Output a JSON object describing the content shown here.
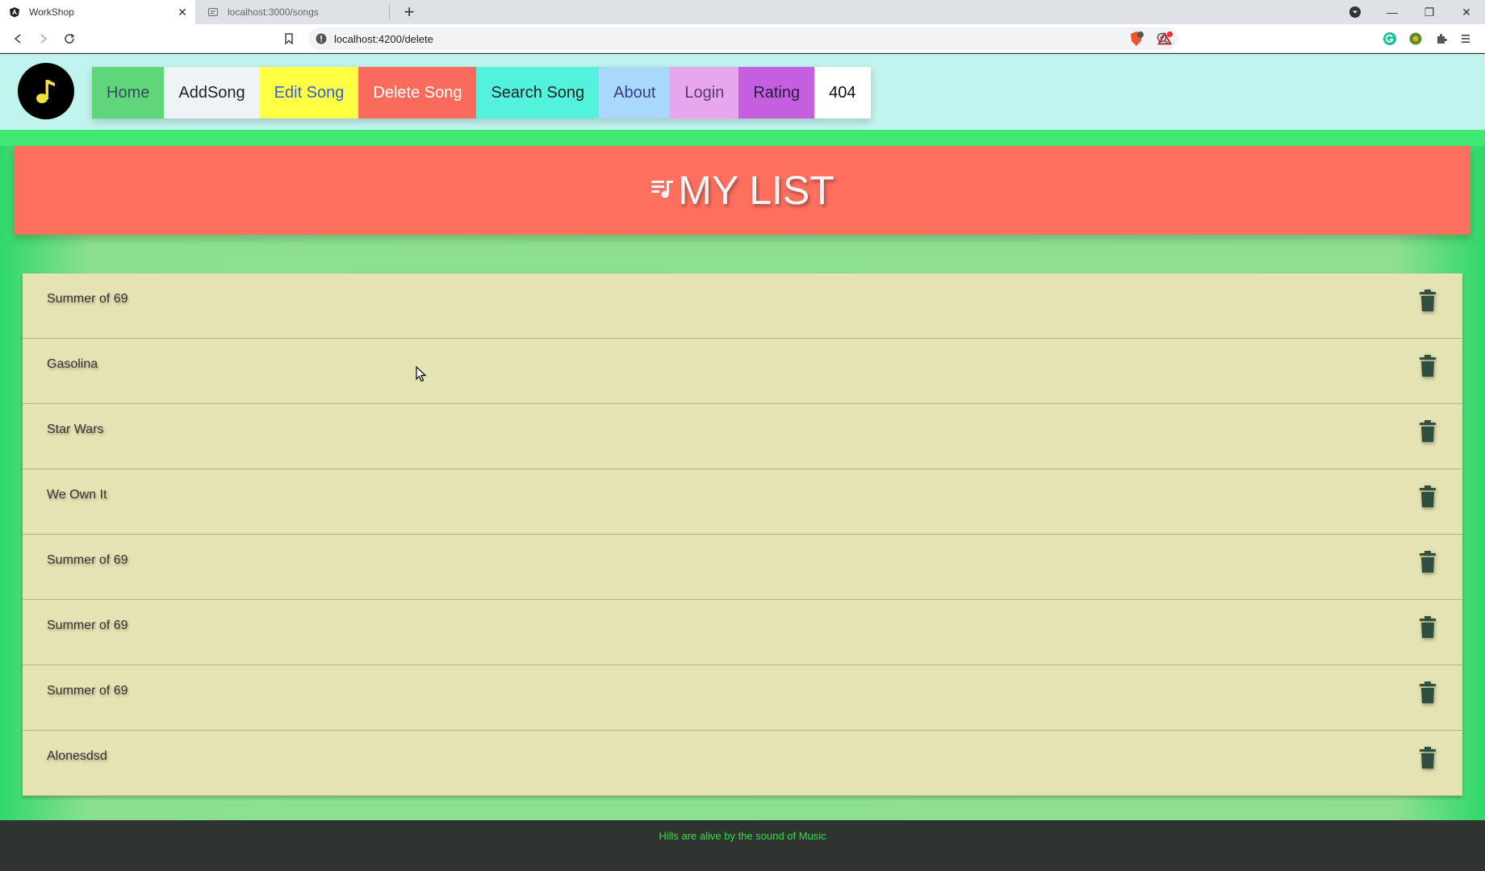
{
  "browser": {
    "tabs": [
      {
        "title": "WorkShop",
        "active": true,
        "icon": "angular-icon"
      },
      {
        "title": "localhost:3000/songs",
        "active": false,
        "icon": "page-icon"
      }
    ],
    "url": "localhost:4200/delete"
  },
  "nav": {
    "items": [
      {
        "label": "Home",
        "bg": "#5fd67a",
        "color": "#3a4a66"
      },
      {
        "label": "AddSong",
        "bg": "#eef3f8",
        "color": "#222222"
      },
      {
        "label": "Edit Song",
        "bg": "#ffff44",
        "color": "#3b5bd6"
      },
      {
        "label": "Delete Song",
        "bg": "#fb6b5b",
        "color": "#ffffff"
      },
      {
        "label": "Search Song",
        "bg": "#52f2dd",
        "color": "#222222"
      },
      {
        "label": "About",
        "bg": "#a8d8fb",
        "color": "#3b3b8c"
      },
      {
        "label": "Login",
        "bg": "#e8a6ef",
        "color": "#5a3a6a"
      },
      {
        "label": "Rating",
        "bg": "#c460e0",
        "color": "#2a1a3a"
      },
      {
        "label": "404",
        "bg": "#ffffff",
        "color": "#111111"
      }
    ]
  },
  "banner": {
    "title": "MY LIST",
    "icon": "queue-music-icon"
  },
  "songs": [
    "Summer of 69",
    "Gasolina",
    "Star Wars",
    "We Own It",
    "Summer of 69",
    "Summer of 69",
    "Summer of 69",
    "Alonesdsd"
  ],
  "footer": {
    "text": "Hills are alive by the sound of Music"
  },
  "colors": {
    "header_bg": "#c2f4ef",
    "banner_bg": "#ff6f5e",
    "row_bg": "#e4e3b3",
    "trash": "#2f4f3f",
    "footer_text": "#33dd44"
  }
}
